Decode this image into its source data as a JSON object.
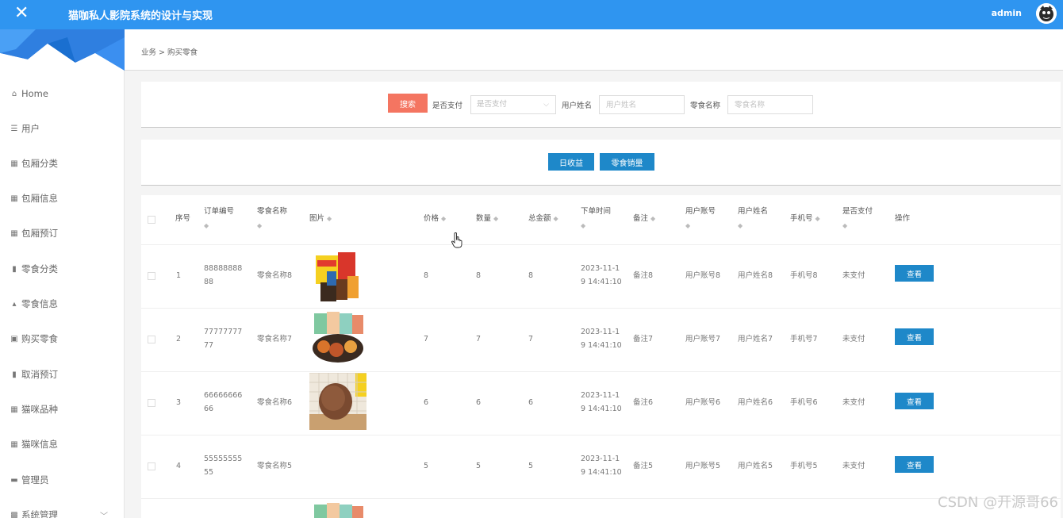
{
  "header": {
    "title": "猫咖私人影院系统的设计与实现",
    "user": "admin",
    "brand_color": "#2f95f0"
  },
  "sidebar": {
    "items": [
      {
        "label": "Home",
        "icon": "home-icon"
      },
      {
        "label": "用户",
        "icon": "list-icon"
      },
      {
        "label": "包厢分类",
        "icon": "grid-icon"
      },
      {
        "label": "包厢信息",
        "icon": "grid-icon"
      },
      {
        "label": "包厢预订",
        "icon": "grid-icon"
      },
      {
        "label": "零食分类",
        "icon": "bar-chart-icon"
      },
      {
        "label": "零食信息",
        "icon": "thumb-icon"
      },
      {
        "label": "购买零食",
        "icon": "clipboard-icon"
      },
      {
        "label": "取消预订",
        "icon": "bar-chart-icon"
      },
      {
        "label": "猫咪品种",
        "icon": "grid-icon"
      },
      {
        "label": "猫咪信息",
        "icon": "grid-icon"
      },
      {
        "label": "管理员",
        "icon": "monitor-icon"
      },
      {
        "label": "系统管理",
        "icon": "settings-icon"
      }
    ]
  },
  "breadcrumb": "业务 > 购买零食",
  "search": {
    "button": "搜索",
    "paid_label": "是否支付",
    "paid_placeholder": "是否支付",
    "username_label": "用户姓名",
    "username_placeholder": "用户姓名",
    "snack_label": "零食名称",
    "snack_placeholder": "零食名称",
    "search_color": "#f47561"
  },
  "actions": {
    "daily_income": "日收益",
    "snack_sales": "零食销量",
    "button_color": "#1e88c9"
  },
  "table": {
    "headers": [
      "序号",
      "订单编号",
      "零食名称",
      "图片",
      "价格",
      "数量",
      "总金额",
      "下单时间",
      "备注",
      "用户账号",
      "用户姓名",
      "手机号",
      "是否支付",
      "操作"
    ],
    "view_label": "查看",
    "rows": [
      {
        "index": "1",
        "order_a": "88888888",
        "order_b": "88",
        "snack": "零食名称8",
        "price": "8",
        "qty": "8",
        "total": "8",
        "time_a": "2023-11-1",
        "time_b": "9 14:41:10",
        "note": "备注8",
        "account": "用户账号8",
        "name": "用户姓名8",
        "phone": "手机号8",
        "paid": "未支付",
        "image": "snack-bag-image"
      },
      {
        "index": "2",
        "order_a": "77777777",
        "order_b": "77",
        "snack": "零食名称7",
        "price": "7",
        "qty": "7",
        "total": "7",
        "time_a": "2023-11-1",
        "time_b": "9 14:41:10",
        "note": "备注7",
        "account": "用户账号7",
        "name": "用户姓名7",
        "phone": "手机号7",
        "paid": "未支付",
        "image": "snack-platter-image"
      },
      {
        "index": "3",
        "order_a": "66666666",
        "order_b": "66",
        "snack": "零食名称6",
        "price": "6",
        "qty": "6",
        "total": "6",
        "time_a": "2023-11-1",
        "time_b": "9 14:41:10",
        "note": "备注6",
        "account": "用户账号6",
        "name": "用户姓名6",
        "phone": "手机号6",
        "paid": "未支付",
        "image": "cookie-image"
      },
      {
        "index": "4",
        "order_a": "55555555",
        "order_b": "55",
        "snack": "零食名称5",
        "price": "5",
        "qty": "5",
        "total": "5",
        "time_a": "2023-11-1",
        "time_b": "9 14:41:10",
        "note": "备注5",
        "account": "用户账号5",
        "name": "用户姓名5",
        "phone": "手机号5",
        "paid": "未支付",
        "image": ""
      }
    ]
  },
  "watermark": "CSDN @开源哥66"
}
